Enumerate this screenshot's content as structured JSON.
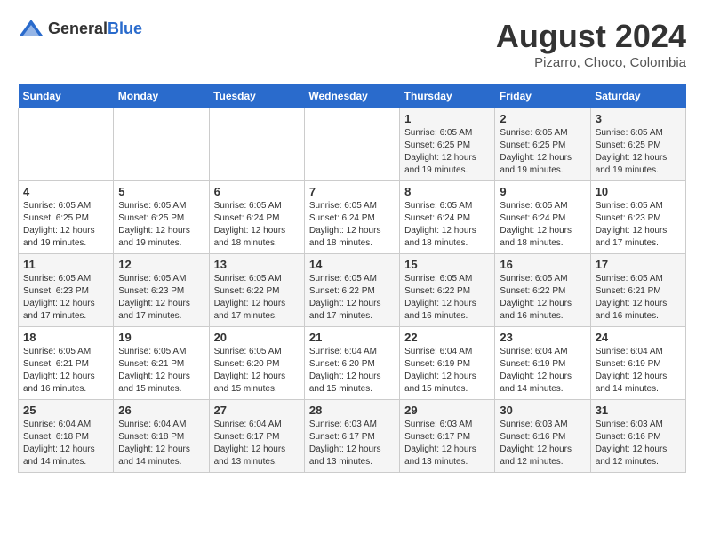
{
  "header": {
    "logo_general": "General",
    "logo_blue": "Blue",
    "title": "August 2024",
    "subtitle": "Pizarro, Choco, Colombia"
  },
  "calendar": {
    "days_of_week": [
      "Sunday",
      "Monday",
      "Tuesday",
      "Wednesday",
      "Thursday",
      "Friday",
      "Saturday"
    ],
    "weeks": [
      [
        {
          "day": "",
          "info": ""
        },
        {
          "day": "",
          "info": ""
        },
        {
          "day": "",
          "info": ""
        },
        {
          "day": "",
          "info": ""
        },
        {
          "day": "1",
          "info": "Sunrise: 6:05 AM\nSunset: 6:25 PM\nDaylight: 12 hours\nand 19 minutes."
        },
        {
          "day": "2",
          "info": "Sunrise: 6:05 AM\nSunset: 6:25 PM\nDaylight: 12 hours\nand 19 minutes."
        },
        {
          "day": "3",
          "info": "Sunrise: 6:05 AM\nSunset: 6:25 PM\nDaylight: 12 hours\nand 19 minutes."
        }
      ],
      [
        {
          "day": "4",
          "info": "Sunrise: 6:05 AM\nSunset: 6:25 PM\nDaylight: 12 hours\nand 19 minutes."
        },
        {
          "day": "5",
          "info": "Sunrise: 6:05 AM\nSunset: 6:25 PM\nDaylight: 12 hours\nand 19 minutes."
        },
        {
          "day": "6",
          "info": "Sunrise: 6:05 AM\nSunset: 6:24 PM\nDaylight: 12 hours\nand 18 minutes."
        },
        {
          "day": "7",
          "info": "Sunrise: 6:05 AM\nSunset: 6:24 PM\nDaylight: 12 hours\nand 18 minutes."
        },
        {
          "day": "8",
          "info": "Sunrise: 6:05 AM\nSunset: 6:24 PM\nDaylight: 12 hours\nand 18 minutes."
        },
        {
          "day": "9",
          "info": "Sunrise: 6:05 AM\nSunset: 6:24 PM\nDaylight: 12 hours\nand 18 minutes."
        },
        {
          "day": "10",
          "info": "Sunrise: 6:05 AM\nSunset: 6:23 PM\nDaylight: 12 hours\nand 17 minutes."
        }
      ],
      [
        {
          "day": "11",
          "info": "Sunrise: 6:05 AM\nSunset: 6:23 PM\nDaylight: 12 hours\nand 17 minutes."
        },
        {
          "day": "12",
          "info": "Sunrise: 6:05 AM\nSunset: 6:23 PM\nDaylight: 12 hours\nand 17 minutes."
        },
        {
          "day": "13",
          "info": "Sunrise: 6:05 AM\nSunset: 6:22 PM\nDaylight: 12 hours\nand 17 minutes."
        },
        {
          "day": "14",
          "info": "Sunrise: 6:05 AM\nSunset: 6:22 PM\nDaylight: 12 hours\nand 17 minutes."
        },
        {
          "day": "15",
          "info": "Sunrise: 6:05 AM\nSunset: 6:22 PM\nDaylight: 12 hours\nand 16 minutes."
        },
        {
          "day": "16",
          "info": "Sunrise: 6:05 AM\nSunset: 6:22 PM\nDaylight: 12 hours\nand 16 minutes."
        },
        {
          "day": "17",
          "info": "Sunrise: 6:05 AM\nSunset: 6:21 PM\nDaylight: 12 hours\nand 16 minutes."
        }
      ],
      [
        {
          "day": "18",
          "info": "Sunrise: 6:05 AM\nSunset: 6:21 PM\nDaylight: 12 hours\nand 16 minutes."
        },
        {
          "day": "19",
          "info": "Sunrise: 6:05 AM\nSunset: 6:21 PM\nDaylight: 12 hours\nand 15 minutes."
        },
        {
          "day": "20",
          "info": "Sunrise: 6:05 AM\nSunset: 6:20 PM\nDaylight: 12 hours\nand 15 minutes."
        },
        {
          "day": "21",
          "info": "Sunrise: 6:04 AM\nSunset: 6:20 PM\nDaylight: 12 hours\nand 15 minutes."
        },
        {
          "day": "22",
          "info": "Sunrise: 6:04 AM\nSunset: 6:19 PM\nDaylight: 12 hours\nand 15 minutes."
        },
        {
          "day": "23",
          "info": "Sunrise: 6:04 AM\nSunset: 6:19 PM\nDaylight: 12 hours\nand 14 minutes."
        },
        {
          "day": "24",
          "info": "Sunrise: 6:04 AM\nSunset: 6:19 PM\nDaylight: 12 hours\nand 14 minutes."
        }
      ],
      [
        {
          "day": "25",
          "info": "Sunrise: 6:04 AM\nSunset: 6:18 PM\nDaylight: 12 hours\nand 14 minutes."
        },
        {
          "day": "26",
          "info": "Sunrise: 6:04 AM\nSunset: 6:18 PM\nDaylight: 12 hours\nand 14 minutes."
        },
        {
          "day": "27",
          "info": "Sunrise: 6:04 AM\nSunset: 6:17 PM\nDaylight: 12 hours\nand 13 minutes."
        },
        {
          "day": "28",
          "info": "Sunrise: 6:03 AM\nSunset: 6:17 PM\nDaylight: 12 hours\nand 13 minutes."
        },
        {
          "day": "29",
          "info": "Sunrise: 6:03 AM\nSunset: 6:17 PM\nDaylight: 12 hours\nand 13 minutes."
        },
        {
          "day": "30",
          "info": "Sunrise: 6:03 AM\nSunset: 6:16 PM\nDaylight: 12 hours\nand 12 minutes."
        },
        {
          "day": "31",
          "info": "Sunrise: 6:03 AM\nSunset: 6:16 PM\nDaylight: 12 hours\nand 12 minutes."
        }
      ]
    ]
  }
}
